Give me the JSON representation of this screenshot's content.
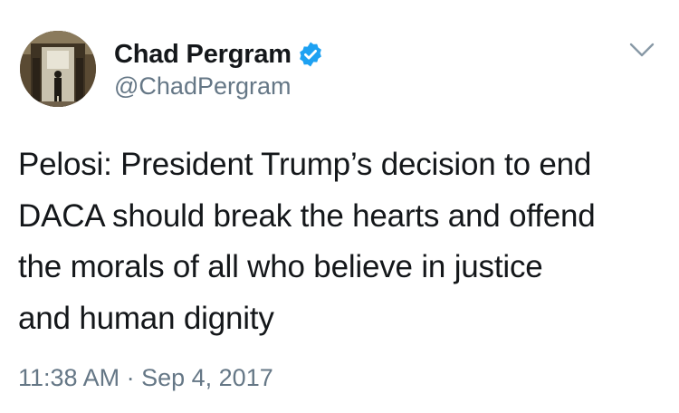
{
  "tweet": {
    "author": {
      "display_name": "Chad Pergram",
      "handle": "@ChadPergram",
      "verified": true,
      "avatar_icon": "profile-photo",
      "verified_color": "#1da1f2"
    },
    "menu_icon": "chevron-down-icon",
    "text_lines": [
      "Pelosi: President Trump’s decision to end",
      "DACA should break the hearts and offend",
      "the morals of all who believe in justice",
      "and human dignity"
    ],
    "time": "11:38 AM",
    "separator": "·",
    "date": "Sep 4, 2017"
  },
  "colors": {
    "text": "#14171a",
    "secondary": "#657786",
    "verified": "#1da1f2"
  }
}
